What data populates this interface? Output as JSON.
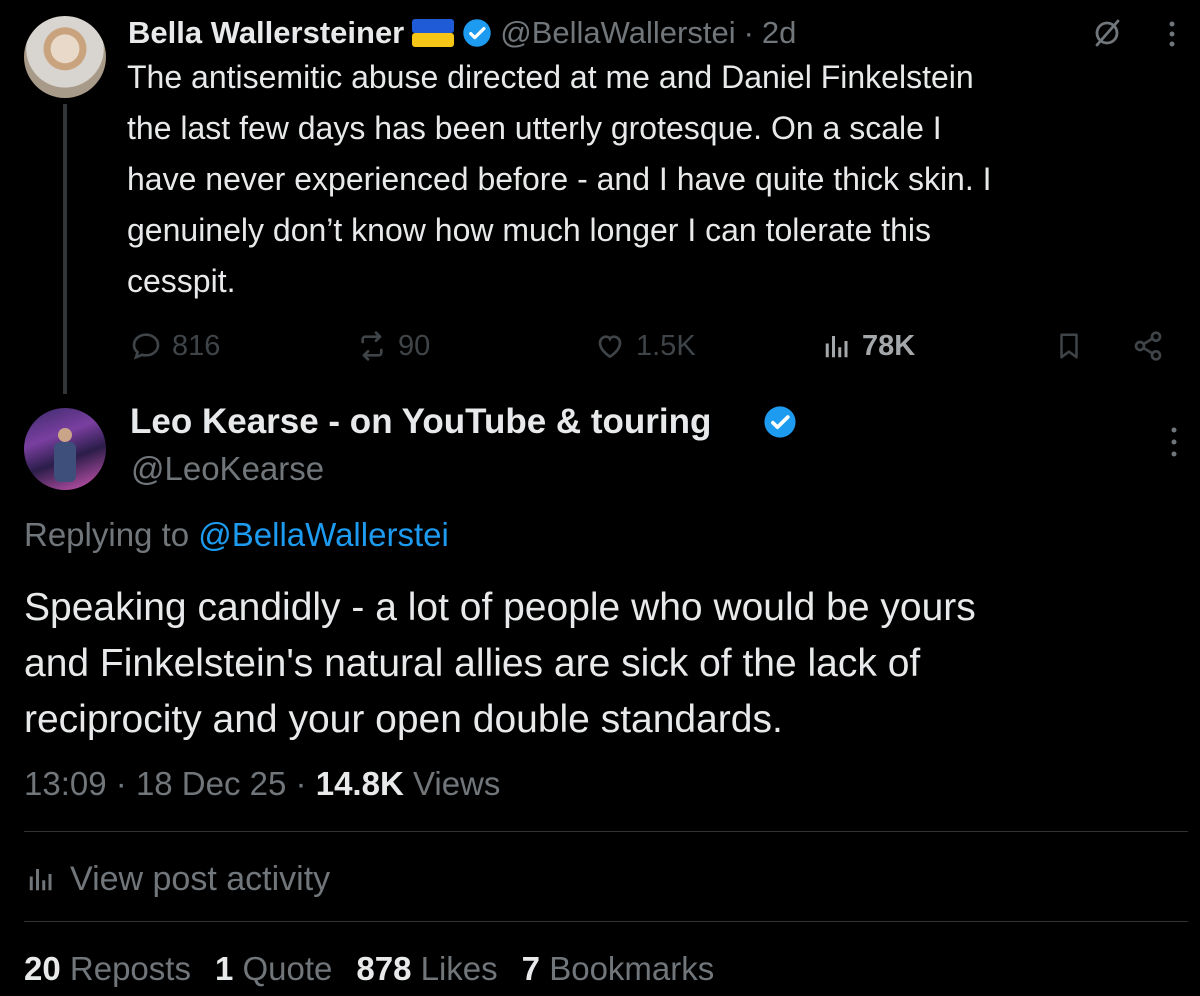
{
  "parent_tweet": {
    "author_name": "Bella Wallersteiner",
    "flag_emoji": "ukraine-flag",
    "handle": "@BellaWallerstei",
    "separator": "·",
    "age": "2d",
    "text_lines": [
      "The antisemitic abuse directed at me and Daniel Finkelstein",
      "the last few days has been utterly grotesque. On a scale I",
      "have never experienced before - and I have quite thick skin. I",
      "genuinely don’t know how much longer I can tolerate this",
      "cesspit."
    ],
    "actions": {
      "replies": "816",
      "reposts": "90",
      "likes": "1.5K",
      "views": "78K"
    }
  },
  "reply_tweet": {
    "author_name": "Leo Kearse - on YouTube & touring",
    "handle": "@LeoKearse",
    "replying_prefix": "Replying to",
    "replying_handle": "@BellaWallerstei",
    "text_lines": [
      "Speaking candidly - a lot of people who would be yours",
      "and Finkelstein's natural allies are sick of the lack of",
      "reciprocity and your open double standards."
    ],
    "time": "13:09",
    "date": "18 Dec 25",
    "sep": "·",
    "views_count": "14.8K",
    "views_label": "Views",
    "activity_label": "View post activity",
    "stats": [
      {
        "count": "20",
        "label": "Reposts"
      },
      {
        "count": "1",
        "label": "Quote"
      },
      {
        "count": "878",
        "label": "Likes"
      },
      {
        "count": "7",
        "label": "Bookmarks"
      }
    ]
  },
  "colors": {
    "background": "#000000",
    "text": "#e7e9ea",
    "muted": "#71767b",
    "accent": "#1d9bf0",
    "verified": "#1d9bf0",
    "divider": "#2f3336"
  }
}
